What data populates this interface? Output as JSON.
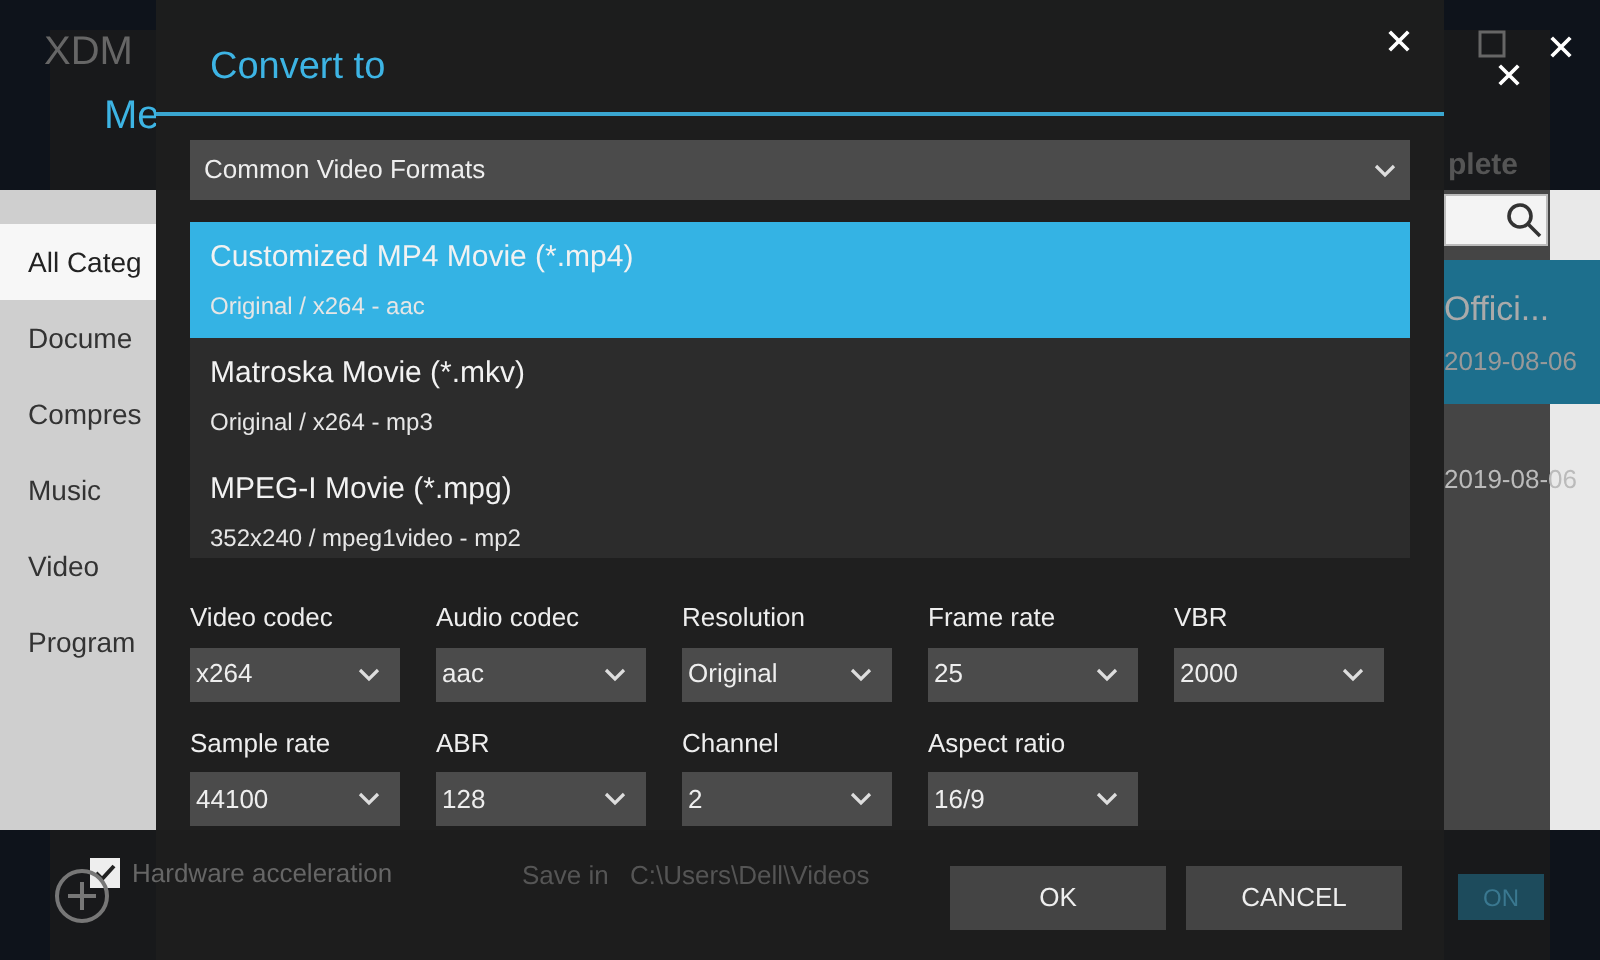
{
  "app": {
    "title": "XDM",
    "tab_label": "plete",
    "sidebar": [
      {
        "label": "All Categ",
        "selected": true
      },
      {
        "label": "Docume",
        "selected": false
      },
      {
        "label": "Compres",
        "selected": false
      },
      {
        "label": "Music",
        "selected": false
      },
      {
        "label": "Video",
        "selected": false
      },
      {
        "label": "Program",
        "selected": false
      }
    ],
    "rows": [
      {
        "title": "Offici...",
        "date": "2019-08-06",
        "selected": true
      },
      {
        "date": "2019-08-06",
        "selected": false
      }
    ]
  },
  "media_converter": {
    "title": "Me",
    "hardware_acceleration": {
      "label": "Hardware acceleration",
      "checked": true
    },
    "save_in_label": "Save in",
    "save_path": "C:\\Users\\Dell\\Videos",
    "on_button": "ON"
  },
  "convert_dialog": {
    "title": "Convert to",
    "category": "Common Video Formats",
    "formats": [
      {
        "name": "Customized MP4 Movie (*.mp4)",
        "detail": "Original / x264 - aac",
        "selected": true
      },
      {
        "name": "Matroska Movie (*.mkv)",
        "detail": "Original / x264 - mp3",
        "selected": false
      },
      {
        "name": "MPEG-I Movie (*.mpg)",
        "detail": "352x240 / mpeg1video - mp2",
        "selected": false
      }
    ],
    "settings": [
      {
        "label": "Video codec",
        "value": "x264"
      },
      {
        "label": "Audio codec",
        "value": "aac"
      },
      {
        "label": "Resolution",
        "value": "Original"
      },
      {
        "label": "Frame rate",
        "value": "25"
      },
      {
        "label": "VBR",
        "value": "2000"
      },
      {
        "label": "Sample rate",
        "value": "44100"
      },
      {
        "label": "ABR",
        "value": "128"
      },
      {
        "label": "Channel",
        "value": "2"
      },
      {
        "label": "Aspect ratio",
        "value": "16/9"
      }
    ],
    "buttons": [
      "OK",
      "CANCEL"
    ]
  }
}
